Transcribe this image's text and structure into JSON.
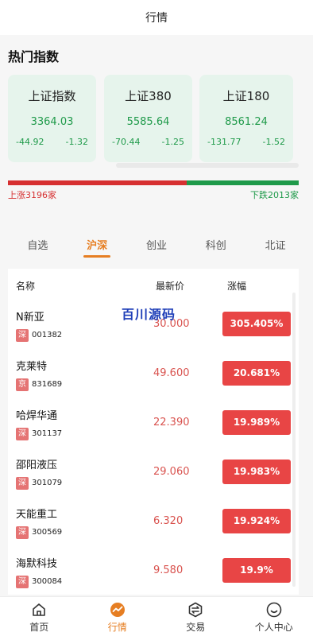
{
  "header": {
    "title": "行情"
  },
  "hot": {
    "title": "热门指数",
    "cards": [
      {
        "name": "上证指数",
        "value": "3364.03",
        "change": "-44.92",
        "pct": "-1.32"
      },
      {
        "name": "上证380",
        "value": "5585.64",
        "change": "-70.44",
        "pct": "-1.25"
      },
      {
        "name": "上证180",
        "value": "8561.24",
        "change": "-131.77",
        "pct": "-1.52"
      }
    ]
  },
  "breadth": {
    "up_label": "上涨3196家",
    "down_label": "下跌2013家",
    "up_count": 3196,
    "down_count": 2013
  },
  "tabs": [
    {
      "label": "自选",
      "active": false
    },
    {
      "label": "沪深",
      "active": true
    },
    {
      "label": "创业",
      "active": false
    },
    {
      "label": "科创",
      "active": false
    },
    {
      "label": "北证",
      "active": false
    }
  ],
  "table": {
    "headers": {
      "name": "名称",
      "price": "最新价",
      "pct": "涨幅"
    },
    "watermark": "百川源码",
    "rows": [
      {
        "name": "N新亚",
        "market": "深",
        "code": "001382",
        "price": "30.000",
        "pct": "305.405%"
      },
      {
        "name": "克莱特",
        "market": "京",
        "code": "831689",
        "price": "49.600",
        "pct": "20.681%"
      },
      {
        "name": "哈焊华通",
        "market": "深",
        "code": "301137",
        "price": "22.390",
        "pct": "19.989%"
      },
      {
        "name": "邵阳液压",
        "market": "深",
        "code": "301079",
        "price": "29.060",
        "pct": "19.983%"
      },
      {
        "name": "天能重工",
        "market": "深",
        "code": "300569",
        "price": "6.320",
        "pct": "19.924%"
      },
      {
        "name": "海默科技",
        "market": "深",
        "code": "300084",
        "price": "9.580",
        "pct": "19.9%"
      }
    ]
  },
  "nav": [
    {
      "label": "首页",
      "icon": "home-icon",
      "active": false
    },
    {
      "label": "行情",
      "icon": "market-icon",
      "active": true
    },
    {
      "label": "交易",
      "icon": "trade-icon",
      "active": false
    },
    {
      "label": "个人中心",
      "icon": "user-icon",
      "active": false
    }
  ],
  "colors": {
    "accent": "#e67e22",
    "up": "#d63031",
    "down": "#1f9a4a"
  }
}
